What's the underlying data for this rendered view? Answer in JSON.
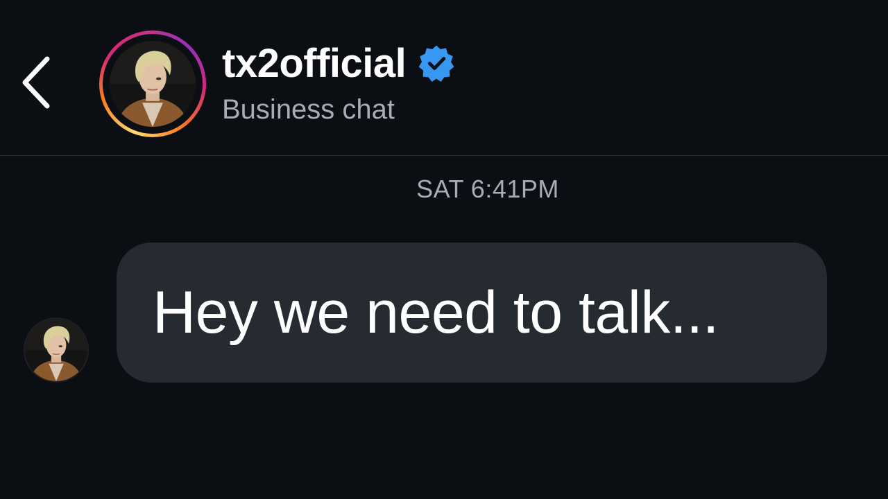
{
  "header": {
    "back_icon": "chevron-left-icon",
    "username": "tx2official",
    "verified_icon": "verified-badge-icon",
    "subtitle": "Business chat"
  },
  "colors": {
    "background": "#0b0f14",
    "bubble": "#262a31",
    "verified": "#3897f0",
    "secondary_text": "#a8adb5"
  },
  "conversation": {
    "timestamp": "SAT 6:41PM",
    "messages": [
      {
        "text": "Hey we need to talk..."
      }
    ]
  }
}
